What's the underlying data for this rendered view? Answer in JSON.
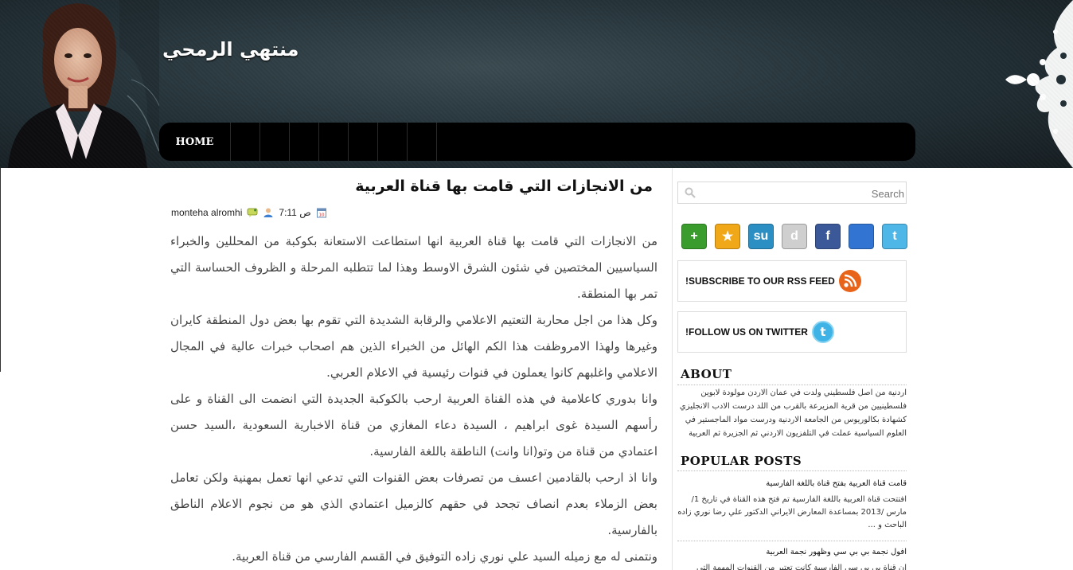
{
  "header": {
    "site_title": "منتهي الرمحي",
    "nav": {
      "home_label": "HOME"
    }
  },
  "post": {
    "title": "من الانجازات التي قامت بها قناة العربية",
    "meta": {
      "time": "7:11 ص",
      "author": "monteha alromhi"
    },
    "paragraphs": [
      "من الانجازات التي قامت بها  قناة العربية انها استطاعت الاستعانة بكوكبة من المحللين والخبراء السياسيين المختصين في شئون الشرق الاوسط وهذا لما تتطلبه المرحلة و  الظروف الحساسة التي تمر بها المنطقة.",
      "وكل هذا من اجل محاربة التعتيم الاعلامي والرقابة الشديدة التي تقوم بها بعض دول المنطقة كايران وغيرها ولهذا الامروظفت هذا الكم الهائل من الخبراء الذين هم اصحاب خبرات عالية في المجال الاعلامي واغلبهم كانوا يعملون في قنوات رئيسية في الاعلام العربي.",
      "وانا بدوري كاعلامية في هذه القناة العربية ارحب  بالكوكبة الجديدة التي انضمت الى القناة و على رأسهم السيدة غوى ابراهيم ، السيدة دعاء المغازي من قناة الاخبارية السعودية ،السيد حسن اعتمادي من قناة من وتو(انا وانت) الناطقة باللغة الفارسية.",
      "وانا اذ ارحب بالقادمين اعسف من تصرفات بعض القنوات التي تدعي انها تعمل بمهنية ولكن تعامل بعض الزملاء بعدم انصاف تجحد في حقهم كالزميل اعتمادي الذي هو من نجوم الاعلام الناطق بالفارسية.",
      "ونتمنى له مع زميله  السيد علي نوري زاده التوفيق  في القسم الفارسي من قناة العربية."
    ]
  },
  "sidebar": {
    "search": {
      "placeholder": "Search"
    },
    "social": [
      {
        "name": "addthis",
        "glyph": "+",
        "color": "#3a9c2c"
      },
      {
        "name": "favorites",
        "glyph": "★",
        "color": "#f0a818"
      },
      {
        "name": "stumbleupon",
        "glyph": "su",
        "color": "#2c8fc4"
      },
      {
        "name": "digg",
        "glyph": "d",
        "color": "#cfcfcf"
      },
      {
        "name": "facebook",
        "glyph": "f",
        "color": "#3b5998"
      },
      {
        "name": "delicious",
        "glyph": "",
        "color": "#3274d1"
      },
      {
        "name": "twitter",
        "glyph": "t",
        "color": "#4fb6e8"
      }
    ],
    "rss_label": "!SUBSCRIBE TO OUR RSS FEED",
    "twitter_label": "!FOLLOW US ON TWITTER",
    "about": {
      "title": "ABOUT",
      "text": "اردنية من اصل فلسطيني ولدت في عمان الاردن مولودة لابوين فلسطينيين من قرية المزيرعة بالقرب من اللد درست الادب الانجليزي كشهادة بكالوريوس من الجامعة الاردنية ودرست مواد الماجستير في العلوم السياسية عملت في التلفزيون الاردني ثم الجزيرة ثم العربية"
    },
    "popular": {
      "title": "POPULAR POSTS",
      "items": [
        {
          "title": "قامت قناة العربية بفتح قناة باللغة الفارسية",
          "snippet": "افتتحت قناة العربية باللغة الفارسية تم فتح هذه القناة في تاريخ 1/مارس /2013 بمساعدة المعارض الايراني الدكتور علي رضا نوري زاده الباحث و ..."
        },
        {
          "title": "افول نجمة بي بي سي وظهور نجمة العربية",
          "snippet": "ان قناة بي بي سي الفارسية كانت تعتبر من القنوات المهمة التي تتحدث باللغة الفارسية"
        }
      ]
    }
  }
}
